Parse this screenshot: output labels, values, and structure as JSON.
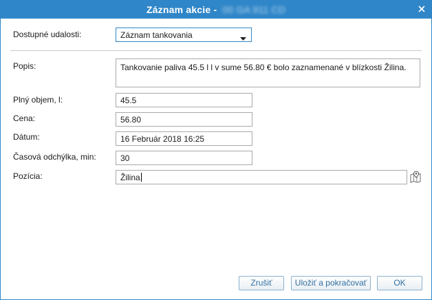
{
  "window": {
    "title": "Záznam akcie -",
    "plate_redacted": "00 GA 911 CD",
    "close_icon": "close-icon"
  },
  "form": {
    "events_label": "Dostupné udalosti:",
    "events_selected": "Záznam tankovania",
    "description_label": "Popis:",
    "description_value": "Tankovanie paliva 45.5 l l v sume 56.80 € bolo zaznamenané v blízkosti Žilina.",
    "volume_label": "Plný objem, l:",
    "volume_value": "45.5",
    "price_label": "Cena:",
    "price_value": "56.80",
    "date_label": "Dátum:",
    "date_value": "16 Február 2018 16:25",
    "offset_label": "Časová odchýlka, min:",
    "offset_value": "30",
    "position_label": "Pozícia:",
    "position_value": "Žilina",
    "map_icon": "map-pin-icon"
  },
  "buttons": {
    "cancel": "Zrušiť",
    "save_continue": "Uložiť a pokračovať",
    "ok": "OK"
  },
  "colors": {
    "accent": "#2f86c8",
    "button_text": "#2f6ea0"
  }
}
